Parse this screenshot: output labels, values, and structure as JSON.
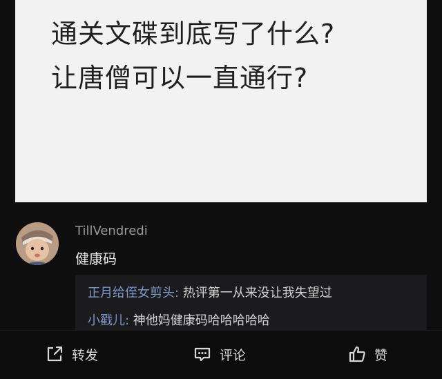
{
  "post": {
    "image_text_line1": "通关文碟到底写了什么?",
    "image_text_line2": "让唐僧可以一直通行?"
  },
  "comment": {
    "username": "TillVendredi",
    "text": "健康码",
    "replies": [
      {
        "author": "正月给侄女剪头",
        "text": "热评第一从来没让我失望过"
      },
      {
        "author": "小戳儿",
        "text": "神他妈健康码哈哈哈哈哈"
      }
    ]
  },
  "actions": {
    "forward_label": "转发",
    "comment_label": "评论",
    "like_label": "赞"
  },
  "icons": {
    "forward": "share-arrow-icon",
    "comment": "comment-bubble-icon",
    "like": "thumbs-up-icon"
  },
  "colors": {
    "background": "#0f0f10",
    "reply_author": "#7d95c9",
    "reply_box": "#1b1b1d"
  }
}
